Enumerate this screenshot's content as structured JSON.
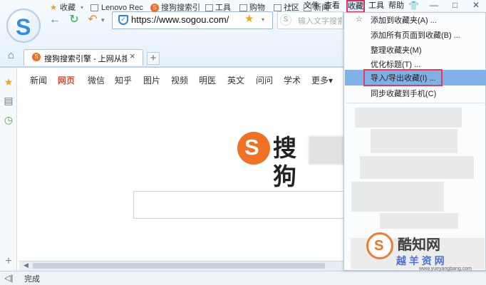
{
  "window": {
    "min_icon": "minimize-icon",
    "max_icon": "maximize-icon",
    "close_icon": "close-icon"
  },
  "menu": {
    "double_arrow": "»",
    "file": "文件",
    "view": "查看",
    "favorites": "收藏",
    "tools": "工具",
    "help": "帮助",
    "skin_icon": "shirt-icon"
  },
  "address": {
    "url": "https://www.sogou.com/",
    "search_placeholder": "输入文字搜索"
  },
  "bookmarks": {
    "favorites": "收藏",
    "lenovo": "Lenovo Rec",
    "sogou": "搜狗搜索引",
    "tools": "工具",
    "shopping": "购物",
    "community": "社区",
    "news": "新闻"
  },
  "tab": {
    "title": "搜狗搜索引擎 - 上网从搜",
    "close": "×",
    "new": "+"
  },
  "site_nav": {
    "news": "新闻",
    "web": "网页",
    "wechat": "微信",
    "zhihu": "知乎",
    "images": "图片",
    "video": "视频",
    "doctor": "明医",
    "english": "英文",
    "ask": "问问",
    "scholar": "学术",
    "more": "更多▾"
  },
  "logo": {
    "symbol": "S",
    "text": "搜狗"
  },
  "dropdown": {
    "add": "添加到收藏夹(A) ...",
    "add_all": "添加所有页面到收藏(B) ...",
    "organize": "整理收藏夹(M)",
    "optimize": "优化标题(T) ...",
    "import_export": "导入/导出收藏(I) ...",
    "sync": "同步收藏到手机(C)"
  },
  "status": {
    "text": "完成"
  },
  "watermark": {
    "main": "酷知网",
    "sub": "越 羊 资 网",
    "url": "www.yueyangbang.com"
  },
  "colors": {
    "accent": "#2f86d9",
    "brand_orange": "#f07123",
    "highlight": "#7fb1e6",
    "red_box": "#e53b5a"
  }
}
